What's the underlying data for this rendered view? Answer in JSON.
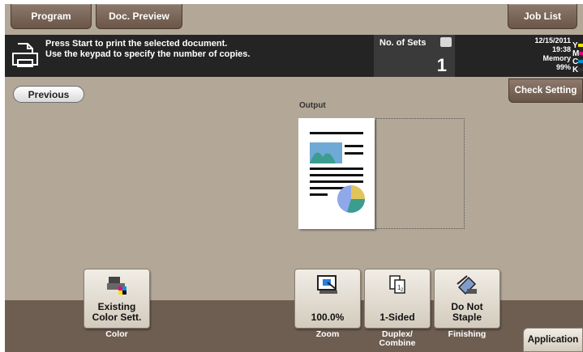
{
  "tabs": {
    "program": "Program",
    "doc_preview": "Doc. Preview",
    "job_list": "Job List"
  },
  "message": {
    "line1": "Press Start to print the selected document.",
    "line2": "Use the keypad to specify the number of copies.",
    "icon": "print-document-icon"
  },
  "sets": {
    "label": "No. of Sets",
    "value": "1",
    "icon": "keypad-icon"
  },
  "status": {
    "date": "12/15/2011",
    "time": "19:38",
    "memory_label": "Memory",
    "memory_value": "99%"
  },
  "toner": [
    {
      "letter": "Y",
      "color": "#f5e400"
    },
    {
      "letter": "M",
      "color": "#e6007e"
    },
    {
      "letter": "C",
      "color": "#0091d8"
    },
    {
      "letter": "K",
      "color": "#333333"
    }
  ],
  "buttons": {
    "previous": "Previous",
    "check_setting": "Check Setting",
    "application": "Application"
  },
  "output_label": "Output",
  "functions": [
    {
      "id": "color",
      "label": "Existing Color Sett.",
      "label_lines": [
        "Existing",
        "Color Sett."
      ],
      "caption": "Color",
      "icon": "color-setting-icon"
    },
    {
      "id": "zoom",
      "label": "100.0%",
      "caption": "Zoom",
      "icon": "zoom-icon"
    },
    {
      "id": "duplex",
      "label": "1-Sided",
      "caption_lines": [
        "Duplex/",
        "Combine"
      ],
      "icon": "duplex-icon"
    },
    {
      "id": "finishing",
      "label_lines": [
        "Do Not",
        "Staple"
      ],
      "caption": "Finishing",
      "icon": "staple-icon"
    }
  ]
}
